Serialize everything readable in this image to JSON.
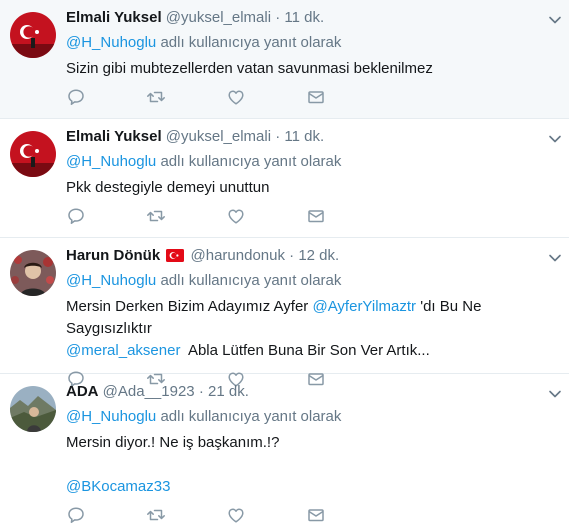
{
  "colors": {
    "link": "#1b95e0",
    "muted": "#657786",
    "text": "#14171a",
    "highlight_bg": "#f5f8fa"
  },
  "tweets": [
    {
      "name": "Elmali Yuksel",
      "handle": "@yuksel_elmali",
      "separator": "·",
      "time": "11 dk.",
      "reply_mention": "@H_Nuhoglu",
      "reply_suffix": " adlı kullanıcıya yanıt olarak",
      "line1": "Sizin gibi mubtezellerden vatan savunmasi beklenilmez"
    },
    {
      "name": "Elmali Yuksel",
      "handle": "@yuksel_elmali",
      "separator": "·",
      "time": "11 dk.",
      "reply_mention": "@H_Nuhoglu",
      "reply_suffix": " adlı kullanıcıya yanıt olarak",
      "line1": "Pkk destegiyle demeyi unuttun"
    },
    {
      "name": "Harun Dönük",
      "flag_icon": "turkey-flag-icon",
      "handle": "@harundonuk",
      "separator": "·",
      "time": "12 dk.",
      "reply_mention": "@H_Nuhoglu",
      "reply_suffix": " adlı kullanıcıya yanıt olarak",
      "line1_a": "Mersin Derken Bizim Adayımız Ayfer ",
      "line1_mention": "@AyferYilmaztr",
      "line1_b": " 'dı Bu Ne Saygısızlıktır",
      "line2_mention": "@meral_aksener",
      "line2_b": "  Abla Lütfen Buna Bir Son Ver Artık..."
    },
    {
      "name": "ADA",
      "handle": "@Ada__1923",
      "separator": "·",
      "time": "21 dk.",
      "reply_mention": "@H_Nuhoglu",
      "reply_suffix": " adlı kullanıcıya yanıt olarak",
      "line1": "Mersin diyor.! Ne iş başkanım.!?",
      "line2_mention": "@BKocamaz33"
    }
  ],
  "icons": [
    "reply-icon",
    "retweet-icon",
    "like-icon",
    "direct-message-icon",
    "chevron-down-icon"
  ]
}
